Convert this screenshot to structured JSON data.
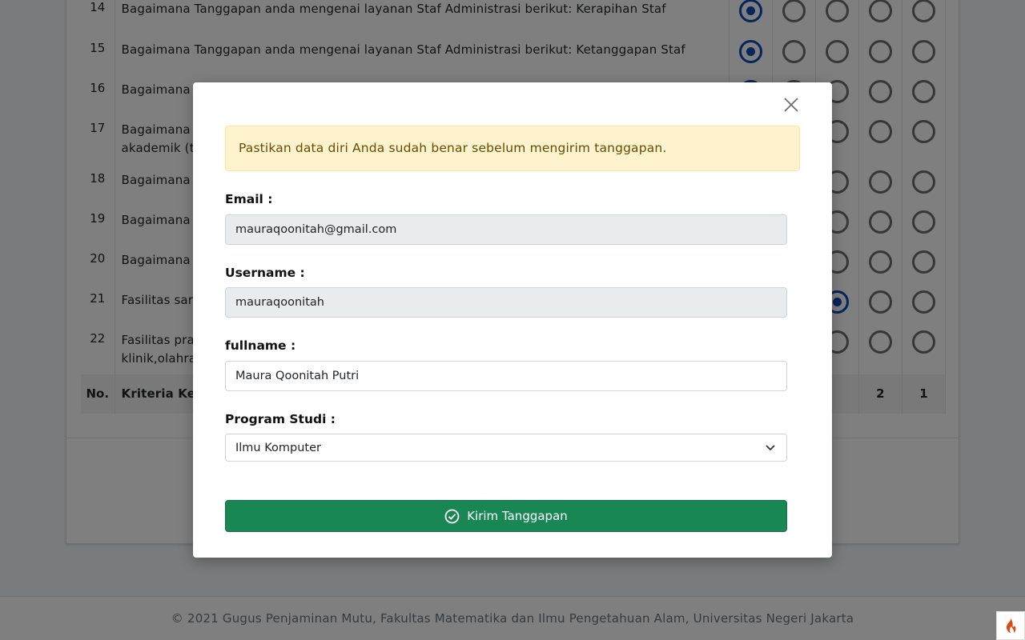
{
  "survey": {
    "rows": [
      {
        "no": "14",
        "text": "Bagaimana Tanggapan anda mengenai layanan Staf Administrasi berikut: Kerapihan Staf",
        "selected": 5
      },
      {
        "no": "15",
        "text": "Bagaimana Tanggapan anda mengenai layanan Staf Administrasi berikut: Ketanggapan Staf",
        "selected": 5
      },
      {
        "no": "16",
        "text": "Bagaimana T",
        "selected": 5
      },
      {
        "no": "17",
        "text": "Bagaimana T",
        "text2": "akademik (tr",
        "selected": null
      },
      {
        "no": "18",
        "text": "Bagaimana T",
        "selected": null
      },
      {
        "no": "19",
        "text": "Bagaimana T",
        "selected": null
      },
      {
        "no": "20",
        "text": "Bagaimana T",
        "selected": null
      },
      {
        "no": "21",
        "text": "Fasilitas sara",
        "selected": 3
      },
      {
        "no": "22",
        "text": "Fasilitas pra",
        "text2": "klinik,olahrag",
        "selected": null
      }
    ],
    "footer_row": {
      "no": "No.",
      "criteria": "Kriteria Kepu",
      "col2": "2",
      "col1": "1"
    }
  },
  "modal": {
    "alert_text": "Pastikan data diri Anda sudah benar sebelum mengirim tanggapan.",
    "email_label": "Email :",
    "email_value": "mauraqoonitah@gmail.com",
    "username_label": "Username :",
    "username_value": "mauraqoonitah",
    "fullname_label": "fullname :",
    "fullname_value": "Maura Qoonitah Putri",
    "program_label": "Program Studi :",
    "program_value": "Ilmu Komputer",
    "submit_label": "Kirim Tanggapan",
    "icons": {
      "close": "close-icon",
      "submit": "check-circle-icon",
      "select": "chevron-down-icon"
    }
  },
  "footer": {
    "text": "© 2021 Gugus Penjaminan Mutu, Fakultas Matematika dan Ilmu Pengetahuan Alam, Universitas Negeri Jakarta"
  },
  "colors": {
    "primary_radio": "#0d4ab8",
    "success": "#198754",
    "alert_bg": "#fff3cd",
    "alert_text": "#664d03"
  }
}
